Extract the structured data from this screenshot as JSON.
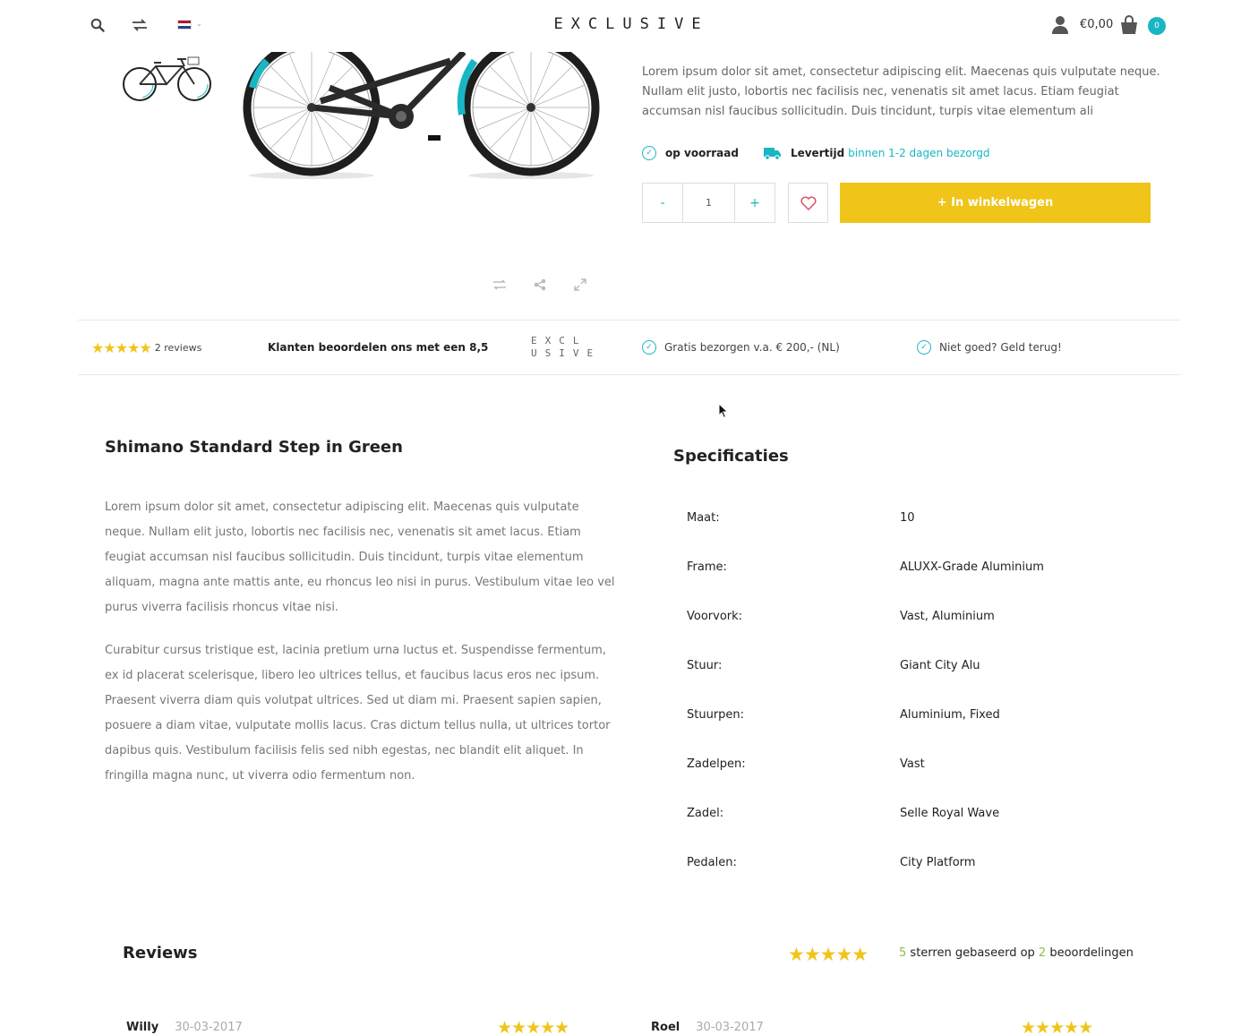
{
  "header": {
    "brand": "EXCLUSIVE",
    "price": "€0,00",
    "cart_count": "0"
  },
  "product": {
    "short_description": "Lorem ipsum dolor sit amet, consectetur adipiscing elit. Maecenas quis vulputate neque. Nullam elit justo, lobortis nec facilisis nec, venenatis sit amet lacus. Etiam feugiat accumsan nisl faucibus sollicitudin. Duis tincidunt, turpis vitae elementum ali",
    "stock_label": "op voorraad",
    "delivery_label": "Levertijd",
    "delivery_value": "binnen 1-2 dagen bezorgd",
    "qty_minus": "-",
    "qty_value": "1",
    "qty_plus": "+",
    "add_to_cart_label": "+ In winkelwagen"
  },
  "usp": {
    "stars": "★★★★★",
    "reviews": "2 reviews",
    "rating_text": "Klanten beoordelen ons met een 8,5",
    "logo_line1": "EXCL",
    "logo_line2": "USIVE",
    "free_shipping": "Gratis bezorgen v.a. € 200,- (NL)",
    "money_back": "Niet goed? Geld terug!"
  },
  "description": {
    "title": "Shimano Standard Step in Green",
    "paragraph1": "Lorem ipsum dolor sit amet, consectetur adipiscing elit. Maecenas quis vulputate neque. Nullam elit justo, lobortis nec facilisis nec, venenatis sit amet lacus. Etiam feugiat accumsan nisl faucibus sollicitudin. Duis tincidunt, turpis vitae elementum aliquam, magna ante mattis ante, eu rhoncus leo nisi in purus. Vestibulum vitae leo vel purus viverra facilisis rhoncus vitae nisi.",
    "paragraph2": "Curabitur cursus tristique est, lacinia pretium urna luctus et. Suspendisse fermentum, ex id placerat scelerisque, libero leo ultrices tellus, et faucibus lacus eros nec ipsum. Praesent viverra diam quis volutpat ultrices. Sed ut diam mi. Praesent sapien sapien, posuere a diam vitae, vulputate mollis lacus. Cras dictum tellus nulla, ut ultrices tortor dapibus quis. Vestibulum facilisis felis sed nibh egestas, nec blandit elit aliquet. In fringilla magna nunc, ut viverra odio fermentum non."
  },
  "specs": {
    "title": "Specificaties",
    "rows": [
      {
        "key": "Maat:",
        "value": "10"
      },
      {
        "key": "Frame:",
        "value": "ALUXX-Grade Aluminium"
      },
      {
        "key": "Voorvork:",
        "value": "Vast, Aluminium"
      },
      {
        "key": "Stuur:",
        "value": "Giant City Alu"
      },
      {
        "key": "Stuurpen:",
        "value": "Aluminium, Fixed"
      },
      {
        "key": "Zadelpen:",
        "value": "Vast"
      },
      {
        "key": "Zadel:",
        "value": "Selle Royal Wave"
      },
      {
        "key": "Pedalen:",
        "value": "City Platform"
      }
    ]
  },
  "reviews": {
    "title": "Reviews",
    "stars": "★★★★★",
    "score": "5",
    "summary_mid": "sterren gebaseerd op",
    "count": "2",
    "summary_end": "beoordelingen",
    "items": [
      {
        "name": "Willy",
        "date": "30-03-2017",
        "stars": "★★★★★"
      },
      {
        "name": "Roel",
        "date": "30-03-2017",
        "stars": "★★★★★"
      }
    ]
  },
  "colors": {
    "accent": "#19b6c4",
    "button": "#f0c419",
    "star": "#f0c419",
    "highlight": "#8cc04a"
  }
}
